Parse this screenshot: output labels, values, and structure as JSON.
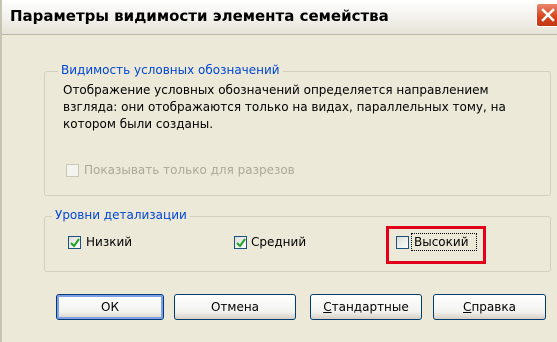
{
  "window": {
    "title": "Параметры видимости элемента семейства"
  },
  "visibility_group": {
    "label": "Видимость условных обозначений",
    "description": "Отображение условных обозначений определяется направлением взгляда: они отображаются только на видах, параллельных тому, на котором были созданы.",
    "sections_only": {
      "label": "Показывать только для разрезов",
      "checked": false,
      "enabled": false
    }
  },
  "detail_group": {
    "label": "Уровни детализации",
    "coarse": {
      "label": "Низкий",
      "checked": true
    },
    "medium": {
      "label": "Средний",
      "checked": true
    },
    "fine": {
      "label": "Высокий",
      "checked": false
    }
  },
  "buttons": {
    "ok": "ОК",
    "cancel": "Отмена",
    "defaults_first": "С",
    "defaults_rest": "тандартные",
    "help_first": "С",
    "help_rest": "правка"
  },
  "colors": {
    "group_label": "#0046d5",
    "highlight": "#e2001a",
    "check": "#21a121"
  }
}
